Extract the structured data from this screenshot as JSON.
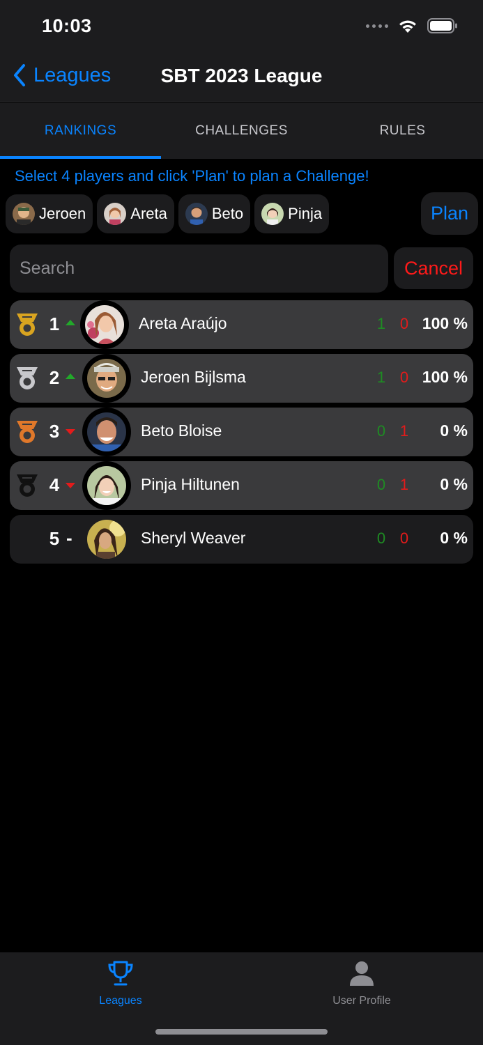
{
  "status_bar": {
    "time": "10:03"
  },
  "nav": {
    "back_label": "Leagues",
    "title": "SBT 2023 League"
  },
  "tabs": [
    {
      "label": "RANKINGS",
      "active": true
    },
    {
      "label": "CHALLENGES",
      "active": false
    },
    {
      "label": "RULES",
      "active": false
    }
  ],
  "instruction": "Select 4 players and click 'Plan' to plan a Challenge!",
  "selected_players": [
    {
      "name": "Jeroen"
    },
    {
      "name": "Areta"
    },
    {
      "name": "Beto"
    },
    {
      "name": "Pinja"
    }
  ],
  "plan_label": "Plan",
  "search": {
    "placeholder": "Search",
    "value": ""
  },
  "cancel_label": "Cancel",
  "rankings": [
    {
      "rank": "1",
      "trend": "up",
      "medal": "gold",
      "name": "Areta Araújo",
      "wins": "1",
      "losses": "0",
      "percent": "100 %"
    },
    {
      "rank": "2",
      "trend": "up",
      "medal": "silver",
      "name": "Jeroen Bijlsma",
      "wins": "1",
      "losses": "0",
      "percent": "100 %"
    },
    {
      "rank": "3",
      "trend": "down",
      "medal": "bronze",
      "name": "Beto Bloise",
      "wins": "0",
      "losses": "1",
      "percent": "0 %"
    },
    {
      "rank": "4",
      "trend": "down",
      "medal": "black",
      "name": "Pinja Hiltunen",
      "wins": "0",
      "losses": "1",
      "percent": "0 %"
    },
    {
      "rank": "5",
      "trend": "-",
      "medal": "none",
      "name": "Sheryl Weaver",
      "wins": "0",
      "losses": "0",
      "percent": "0 %"
    }
  ],
  "bottom_tabs": [
    {
      "label": "Leagues",
      "icon": "trophy-icon",
      "active": true
    },
    {
      "label": "User Profile",
      "icon": "person-icon",
      "active": false
    }
  ],
  "colors": {
    "accent": "#0a84ff",
    "win": "#1e8c23",
    "loss": "#e31b1b",
    "gold": "#d9a420",
    "silver": "#c8c8cc",
    "bronze": "#e0782a"
  }
}
